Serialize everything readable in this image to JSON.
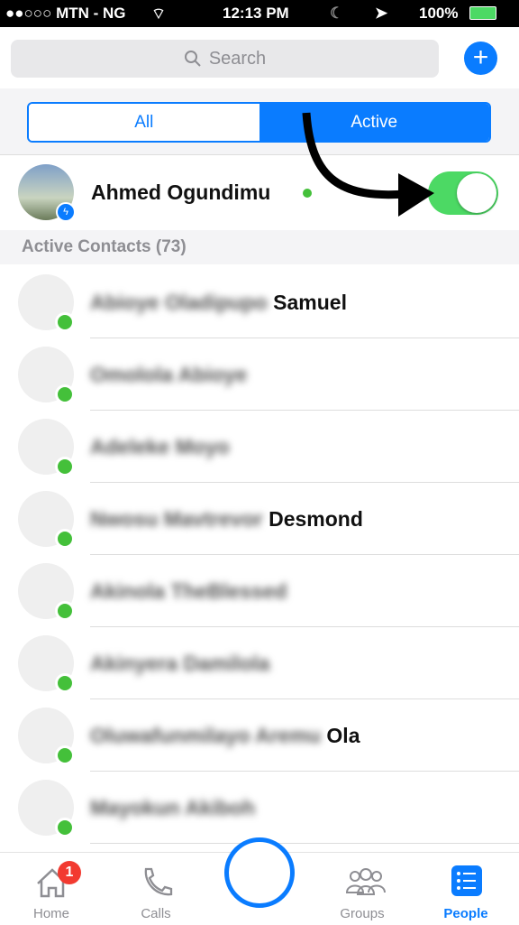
{
  "status": {
    "carrier": "●●○○○ MTN - NG",
    "time": "12:13 PM",
    "battery": "100%"
  },
  "search": {
    "placeholder": "Search"
  },
  "segments": {
    "all": "All",
    "active": "Active"
  },
  "me": {
    "name": "Ahmed Ogundimu",
    "active_status": true
  },
  "section": {
    "title": "Active Contacts (73)"
  },
  "contacts": [
    {
      "blurred": "Abioye Oladipupo",
      "name": "Samuel"
    },
    {
      "blurred": "Omolola Abioye",
      "name": ""
    },
    {
      "blurred": "Adeleke Moyo",
      "name": ""
    },
    {
      "blurred": "Nwosu Mavtrevor",
      "name": "Desmond"
    },
    {
      "blurred": "Akinola TheBlessed",
      "name": ""
    },
    {
      "blurred": "Akinyera Damilola",
      "name": ""
    },
    {
      "blurred": "Oluwafunmilayo Aremu",
      "name": "Ola"
    },
    {
      "blurred": "Mayokun Akiboh",
      "name": ""
    }
  ],
  "tabbar": {
    "home": "Home",
    "home_badge": "1",
    "calls": "Calls",
    "groups": "Groups",
    "people": "People"
  },
  "colors": {
    "accent": "#0a7cff",
    "online": "#44c03a",
    "toggle": "#4cd964"
  }
}
